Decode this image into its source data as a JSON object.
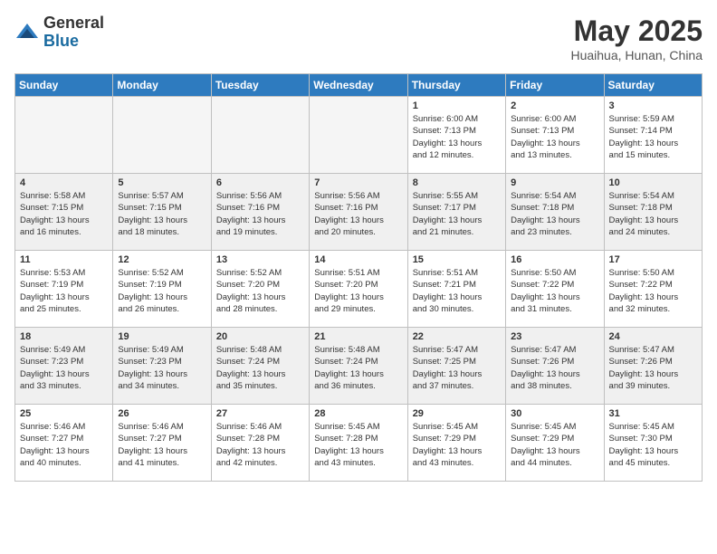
{
  "header": {
    "logo_general": "General",
    "logo_blue": "Blue",
    "title": "May 2025",
    "location": "Huaihua, Hunan, China"
  },
  "days_of_week": [
    "Sunday",
    "Monday",
    "Tuesday",
    "Wednesday",
    "Thursday",
    "Friday",
    "Saturday"
  ],
  "weeks": [
    [
      {
        "day": "",
        "info": "",
        "empty": true
      },
      {
        "day": "",
        "info": "",
        "empty": true
      },
      {
        "day": "",
        "info": "",
        "empty": true
      },
      {
        "day": "",
        "info": "",
        "empty": true
      },
      {
        "day": "1",
        "info": "Sunrise: 6:00 AM\nSunset: 7:13 PM\nDaylight: 13 hours\nand 12 minutes.",
        "empty": false
      },
      {
        "day": "2",
        "info": "Sunrise: 6:00 AM\nSunset: 7:13 PM\nDaylight: 13 hours\nand 13 minutes.",
        "empty": false
      },
      {
        "day": "3",
        "info": "Sunrise: 5:59 AM\nSunset: 7:14 PM\nDaylight: 13 hours\nand 15 minutes.",
        "empty": false
      }
    ],
    [
      {
        "day": "4",
        "info": "Sunrise: 5:58 AM\nSunset: 7:15 PM\nDaylight: 13 hours\nand 16 minutes.",
        "empty": false
      },
      {
        "day": "5",
        "info": "Sunrise: 5:57 AM\nSunset: 7:15 PM\nDaylight: 13 hours\nand 18 minutes.",
        "empty": false
      },
      {
        "day": "6",
        "info": "Sunrise: 5:56 AM\nSunset: 7:16 PM\nDaylight: 13 hours\nand 19 minutes.",
        "empty": false
      },
      {
        "day": "7",
        "info": "Sunrise: 5:56 AM\nSunset: 7:16 PM\nDaylight: 13 hours\nand 20 minutes.",
        "empty": false
      },
      {
        "day": "8",
        "info": "Sunrise: 5:55 AM\nSunset: 7:17 PM\nDaylight: 13 hours\nand 21 minutes.",
        "empty": false
      },
      {
        "day": "9",
        "info": "Sunrise: 5:54 AM\nSunset: 7:18 PM\nDaylight: 13 hours\nand 23 minutes.",
        "empty": false
      },
      {
        "day": "10",
        "info": "Sunrise: 5:54 AM\nSunset: 7:18 PM\nDaylight: 13 hours\nand 24 minutes.",
        "empty": false
      }
    ],
    [
      {
        "day": "11",
        "info": "Sunrise: 5:53 AM\nSunset: 7:19 PM\nDaylight: 13 hours\nand 25 minutes.",
        "empty": false
      },
      {
        "day": "12",
        "info": "Sunrise: 5:52 AM\nSunset: 7:19 PM\nDaylight: 13 hours\nand 26 minutes.",
        "empty": false
      },
      {
        "day": "13",
        "info": "Sunrise: 5:52 AM\nSunset: 7:20 PM\nDaylight: 13 hours\nand 28 minutes.",
        "empty": false
      },
      {
        "day": "14",
        "info": "Sunrise: 5:51 AM\nSunset: 7:20 PM\nDaylight: 13 hours\nand 29 minutes.",
        "empty": false
      },
      {
        "day": "15",
        "info": "Sunrise: 5:51 AM\nSunset: 7:21 PM\nDaylight: 13 hours\nand 30 minutes.",
        "empty": false
      },
      {
        "day": "16",
        "info": "Sunrise: 5:50 AM\nSunset: 7:22 PM\nDaylight: 13 hours\nand 31 minutes.",
        "empty": false
      },
      {
        "day": "17",
        "info": "Sunrise: 5:50 AM\nSunset: 7:22 PM\nDaylight: 13 hours\nand 32 minutes.",
        "empty": false
      }
    ],
    [
      {
        "day": "18",
        "info": "Sunrise: 5:49 AM\nSunset: 7:23 PM\nDaylight: 13 hours\nand 33 minutes.",
        "empty": false
      },
      {
        "day": "19",
        "info": "Sunrise: 5:49 AM\nSunset: 7:23 PM\nDaylight: 13 hours\nand 34 minutes.",
        "empty": false
      },
      {
        "day": "20",
        "info": "Sunrise: 5:48 AM\nSunset: 7:24 PM\nDaylight: 13 hours\nand 35 minutes.",
        "empty": false
      },
      {
        "day": "21",
        "info": "Sunrise: 5:48 AM\nSunset: 7:24 PM\nDaylight: 13 hours\nand 36 minutes.",
        "empty": false
      },
      {
        "day": "22",
        "info": "Sunrise: 5:47 AM\nSunset: 7:25 PM\nDaylight: 13 hours\nand 37 minutes.",
        "empty": false
      },
      {
        "day": "23",
        "info": "Sunrise: 5:47 AM\nSunset: 7:26 PM\nDaylight: 13 hours\nand 38 minutes.",
        "empty": false
      },
      {
        "day": "24",
        "info": "Sunrise: 5:47 AM\nSunset: 7:26 PM\nDaylight: 13 hours\nand 39 minutes.",
        "empty": false
      }
    ],
    [
      {
        "day": "25",
        "info": "Sunrise: 5:46 AM\nSunset: 7:27 PM\nDaylight: 13 hours\nand 40 minutes.",
        "empty": false
      },
      {
        "day": "26",
        "info": "Sunrise: 5:46 AM\nSunset: 7:27 PM\nDaylight: 13 hours\nand 41 minutes.",
        "empty": false
      },
      {
        "day": "27",
        "info": "Sunrise: 5:46 AM\nSunset: 7:28 PM\nDaylight: 13 hours\nand 42 minutes.",
        "empty": false
      },
      {
        "day": "28",
        "info": "Sunrise: 5:45 AM\nSunset: 7:28 PM\nDaylight: 13 hours\nand 43 minutes.",
        "empty": false
      },
      {
        "day": "29",
        "info": "Sunrise: 5:45 AM\nSunset: 7:29 PM\nDaylight: 13 hours\nand 43 minutes.",
        "empty": false
      },
      {
        "day": "30",
        "info": "Sunrise: 5:45 AM\nSunset: 7:29 PM\nDaylight: 13 hours\nand 44 minutes.",
        "empty": false
      },
      {
        "day": "31",
        "info": "Sunrise: 5:45 AM\nSunset: 7:30 PM\nDaylight: 13 hours\nand 45 minutes.",
        "empty": false
      }
    ]
  ]
}
